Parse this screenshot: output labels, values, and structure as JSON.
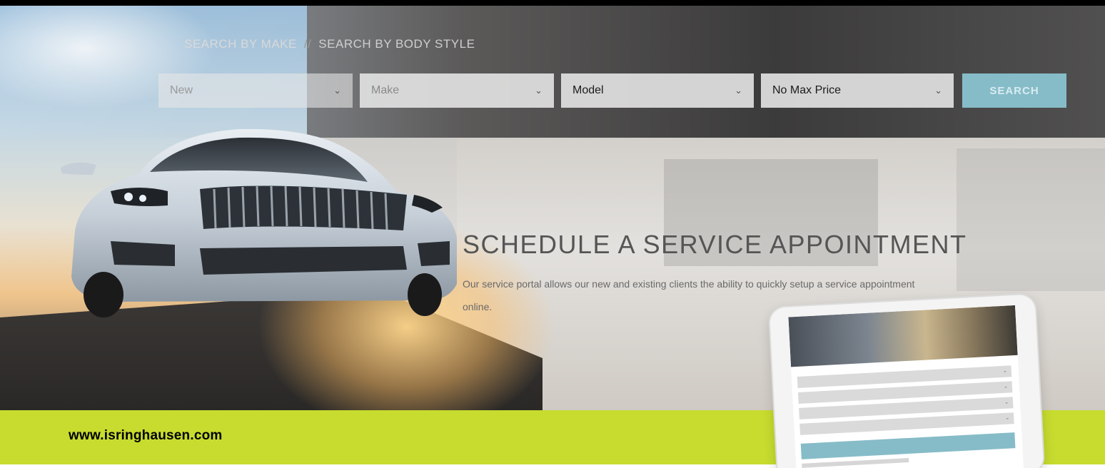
{
  "search": {
    "tabs": [
      "SEARCH BY MAKE",
      "SEARCH BY BODY STYLE"
    ],
    "separator": "//",
    "fields": [
      {
        "label": "New",
        "selected": "New"
      },
      {
        "label": "Make",
        "selected": "Make"
      },
      {
        "label": "Model",
        "selected": "Model"
      },
      {
        "label": "No Max Price",
        "selected": "No Max Price"
      }
    ],
    "button_label": "SEARCH",
    "chevron": "⌄"
  },
  "service": {
    "title": "SCHEDULE A SERVICE APPOINTMENT",
    "description": "Our service portal allows our new and existing clients the ability to quickly setup a service appointment online."
  },
  "footer": {
    "url": "www.isringhausen.com"
  },
  "colors": {
    "accent_green": "#c7dc2f",
    "search_button": "#86bcc8"
  }
}
